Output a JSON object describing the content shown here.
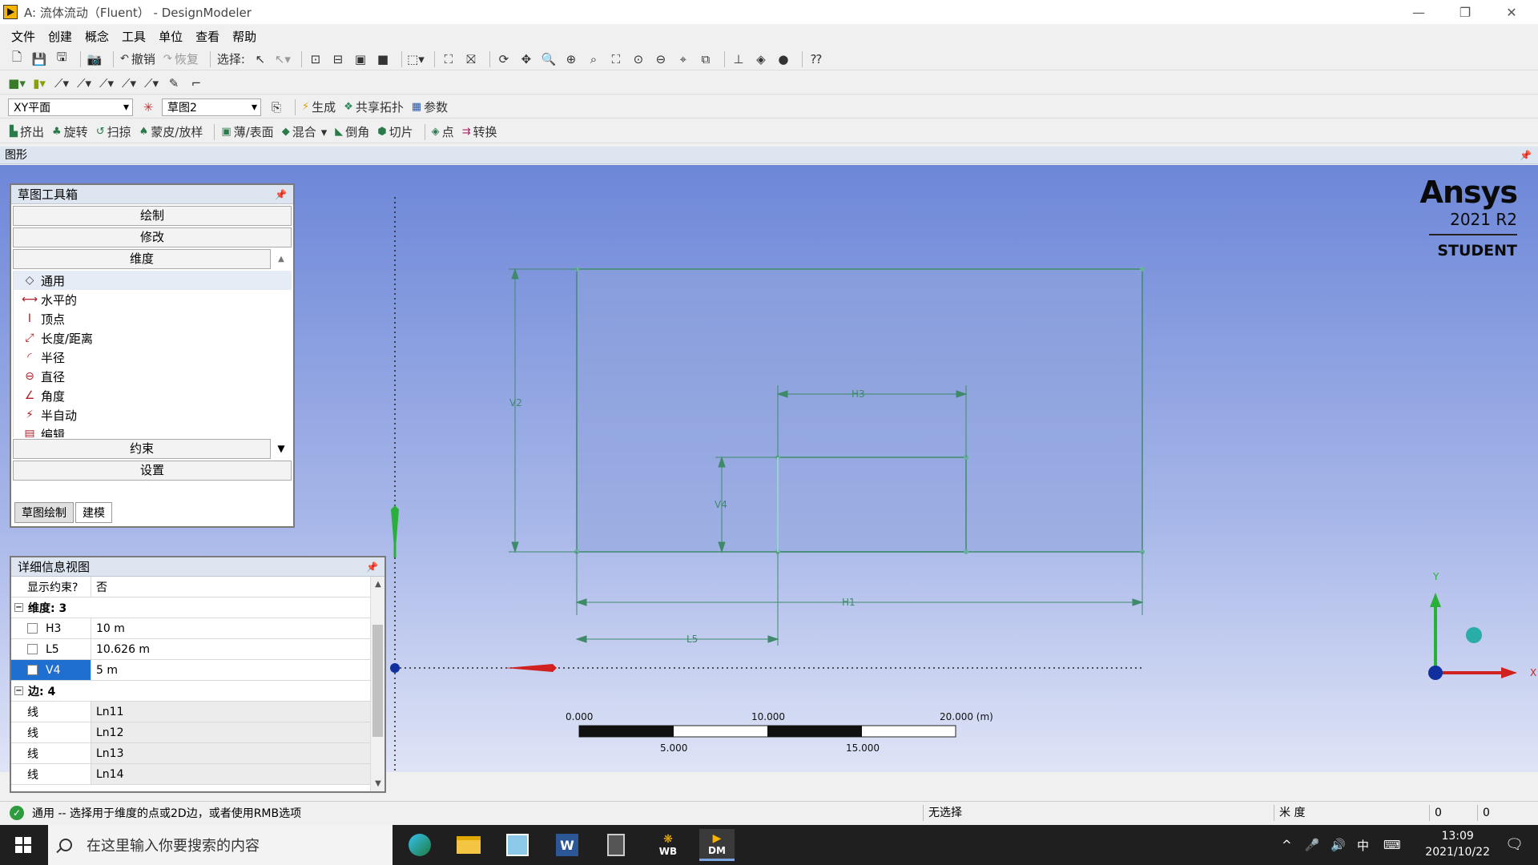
{
  "window": {
    "title": "A: 流体流动（Fluent） - DesignModeler",
    "minimize": "—",
    "restore": "❐",
    "close": "✕"
  },
  "menu": [
    "文件",
    "创建",
    "概念",
    "工具",
    "单位",
    "查看",
    "帮助"
  ],
  "toolbar1": {
    "undo": "撤销",
    "redo": "恢复",
    "select_label": "选择:"
  },
  "toolbar3": {
    "plane": "XY平面",
    "sketch": "草图2",
    "generate": "生成",
    "share_topology": "共享拓扑",
    "parameters": "参数"
  },
  "toolbar4": [
    "挤出",
    "旋转",
    "扫掠",
    "蒙皮/放样",
    "薄/表面",
    "混合",
    "倒角",
    "切片",
    "点",
    "转换"
  ],
  "graphics": {
    "title": "图形",
    "brand": {
      "name": "Ansys",
      "version": "2021 R2",
      "edition": "STUDENT"
    },
    "dimensions": {
      "v2": "V2",
      "h3": "H3",
      "v4": "V4",
      "h1": "H1",
      "l5": "L5"
    },
    "scale": {
      "t0": "0.000",
      "t10": "10.000",
      "t20": "20.000 (m)",
      "t5": "5.000",
      "t15": "15.000"
    },
    "axes": {
      "x": "X",
      "y": "Y"
    }
  },
  "toolbox": {
    "title": "草图工具箱",
    "sections": {
      "draw": "绘制",
      "modify": "修改",
      "dimensions": "维度",
      "constraints": "约束",
      "settings": "设置"
    },
    "items": [
      {
        "label": "通用",
        "icon": "◇"
      },
      {
        "label": "水平的",
        "icon": "⟷"
      },
      {
        "label": "顶点",
        "icon": "I"
      },
      {
        "label": "长度/距离",
        "icon": "⤢"
      },
      {
        "label": "半径",
        "icon": "◜"
      },
      {
        "label": "直径",
        "icon": "⊖"
      },
      {
        "label": "角度",
        "icon": "∠"
      },
      {
        "label": "半自动",
        "icon": "⚡"
      },
      {
        "label": "编辑",
        "icon": "▤"
      }
    ],
    "tabs": {
      "sketching": "草图绘制",
      "modeling": "建模"
    }
  },
  "details": {
    "title": "详细信息视图",
    "show_constraints_label": "显示约束?",
    "show_constraints_value": "否",
    "dimensions_group": "维度: 3",
    "dims": [
      {
        "name": "H3",
        "value": "10 m"
      },
      {
        "name": "L5",
        "value": "10.626 m"
      },
      {
        "name": "V4",
        "value": "5 m"
      }
    ],
    "edges_group": "边: 4",
    "edges": [
      {
        "type": "线",
        "name": "Ln11"
      },
      {
        "type": "线",
        "name": "Ln12"
      },
      {
        "type": "线",
        "name": "Ln13"
      },
      {
        "type": "线",
        "name": "Ln14"
      }
    ]
  },
  "status": {
    "message": "通用 -- 选择用于维度的点或2D边，或者使用RMB选项",
    "selection": "无选择",
    "units": "米   度",
    "v1": "0",
    "v2": "0"
  },
  "taskbar": {
    "search_placeholder": "在这里输入你要搜索的内容",
    "time": "13:09",
    "date": "2021/10/22",
    "ime": "中",
    "wb_label": "WB",
    "dm_label": "DM"
  }
}
